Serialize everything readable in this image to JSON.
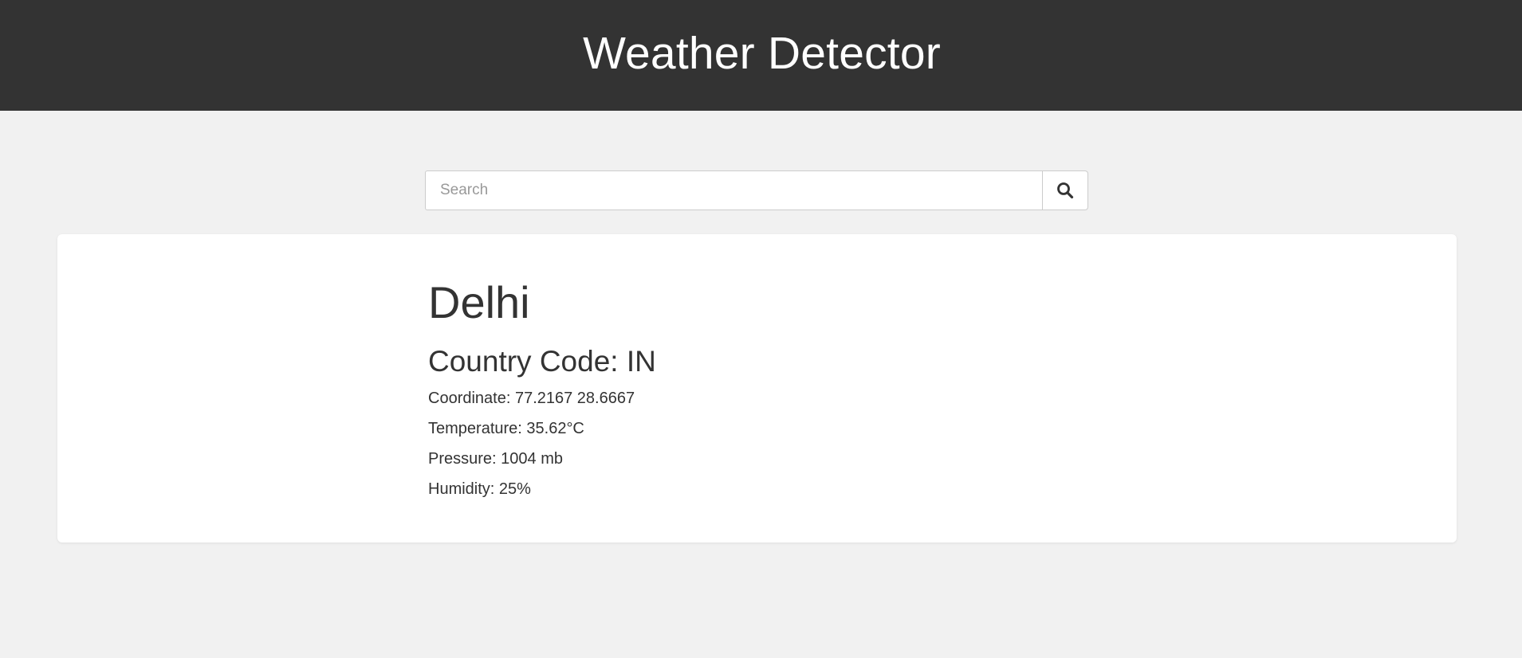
{
  "header": {
    "title": "Weather Detector"
  },
  "search": {
    "placeholder": "Search",
    "value": "",
    "button_icon": "search-icon"
  },
  "weather": {
    "city": "Delhi",
    "country_code": "Country Code: IN",
    "coordinate": "Coordinate: 77.2167 28.6667",
    "temperature": "Temperature: 35.62°C",
    "pressure": "Pressure: 1004 mb",
    "humidity": "Humidity: 25%"
  },
  "colors": {
    "header_bg": "#333333",
    "page_bg": "#f1f1f1",
    "card_bg": "#ffffff",
    "text": "#333333"
  }
}
